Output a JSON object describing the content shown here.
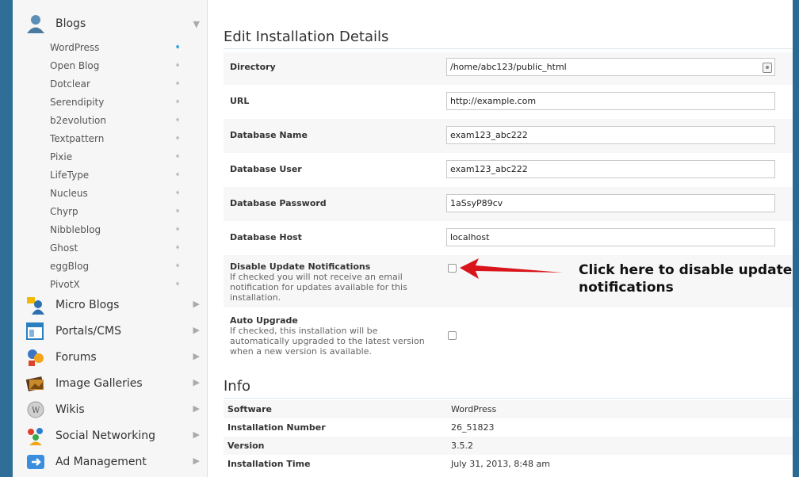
{
  "sidebar": {
    "categories": [
      {
        "label": "Blogs",
        "icon": "user-blog-icon"
      },
      {
        "label": "Micro Blogs",
        "icon": "micro-blogs-icon"
      },
      {
        "label": "Portals/CMS",
        "icon": "portals-icon"
      },
      {
        "label": "Forums",
        "icon": "forums-icon"
      },
      {
        "label": "Image Galleries",
        "icon": "image-gallery-icon"
      },
      {
        "label": "Wikis",
        "icon": "wiki-puzzle-icon"
      },
      {
        "label": "Social Networking",
        "icon": "social-networking-icon"
      },
      {
        "label": "Ad Management",
        "icon": "ad-management-icon"
      }
    ],
    "blog_items": [
      "WordPress",
      "Open Blog",
      "Dotclear",
      "Serendipity",
      "b2evolution",
      "Textpattern",
      "Pixie",
      "LifeType",
      "Nucleus",
      "Chyrp",
      "Nibbleblog",
      "Ghost",
      "eggBlog",
      "PivotX"
    ]
  },
  "edit": {
    "title": "Edit Installation Details",
    "fields": [
      {
        "label": "Directory",
        "value": "/home/abc123/public_html"
      },
      {
        "label": "URL",
        "value": "http://example.com"
      },
      {
        "label": "Database Name",
        "value": "exam123_abc222"
      },
      {
        "label": "Database User",
        "value": "exam123_abc222"
      },
      {
        "label": "Database Password",
        "value": "1aSsyP89cv"
      },
      {
        "label": "Database Host",
        "value": "localhost"
      }
    ],
    "disable_updates": {
      "label": "Disable Update Notifications",
      "desc": "If checked you will not receive an email notification for updates available for this installation."
    },
    "auto_upgrade": {
      "label": "Auto Upgrade",
      "desc": "If checked, this installation will be automatically upgraded to the latest version when a new version is available."
    },
    "callout": "Click here to disable update notifications"
  },
  "info": {
    "title": "Info",
    "rows": [
      {
        "label": "Software",
        "value": "WordPress"
      },
      {
        "label": "Installation Number",
        "value": "26_51823"
      },
      {
        "label": "Version",
        "value": "3.5.2"
      },
      {
        "label": "Installation Time",
        "value": "July 31, 2013, 8:48 am"
      }
    ]
  },
  "colors": {
    "accent": "#1a9ad9",
    "arrow": "#d9141b"
  }
}
